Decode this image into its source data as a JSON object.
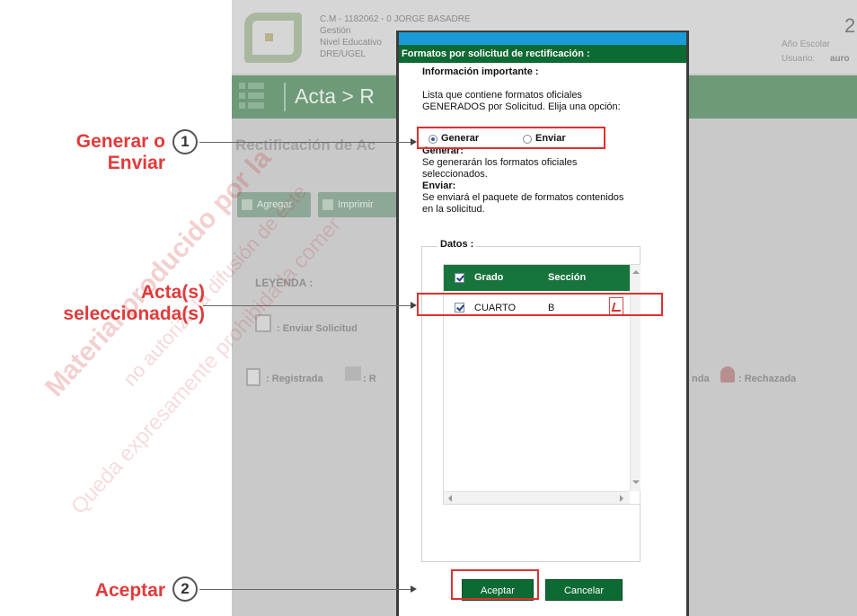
{
  "app": {
    "header": {
      "line1": "C.M - 1182062 - 0  JORGE BASADRE",
      "line2": "Gestión",
      "line3": "Nivel Educativo",
      "line4": "DRE/UGEL",
      "anio_label": "Año Escolar",
      "anio_digit": "2",
      "usuario_label": "Usuario:",
      "usuario_value": "auro"
    },
    "nav_title": "Acta > R",
    "subtitle": "Rectificación de Ac",
    "buttons": {
      "agregar": "Agregar",
      "imprimir": "Imprimir"
    },
    "leyenda": "LEYENDA :",
    "enviar_solicitud": ": Enviar Solicitud",
    "legend_registrada": ": Registrada",
    "legend_r": ": R",
    "legend_nada": "nda",
    "legend_rechazada": ": Rechazada"
  },
  "modal": {
    "title": "Formatos por solicitud de rectificación :",
    "info_heading": "Información importante :",
    "info_text_1": "Lista que contiene formatos oficiales",
    "info_text_2": "GENERADOS por Solicitud. Elija una opción:",
    "radio_generar": "Generar",
    "radio_enviar": "Enviar",
    "selected_option": "Generar",
    "generar_heading": "Generar:",
    "generar_text_1": "Se generarán los formatos oficiales",
    "generar_text_2": "seleccionados.",
    "enviar_heading": "Enviar:",
    "enviar_text_1": "Se enviará el paquete de formatos contenidos",
    "enviar_text_2": "en la solicitud.",
    "datos_label": "Datos :",
    "grid": {
      "columns": [
        "Grado",
        "Sección"
      ],
      "rows": [
        {
          "grado": "CUARTO",
          "seccion": "B",
          "checked": true
        }
      ]
    },
    "btn_aceptar": "Aceptar",
    "btn_cancelar": "Cancelar"
  },
  "annotations": {
    "step1_line1": "Generar o",
    "step1_line2": "Enviar",
    "step1_num": "1",
    "actas_line1": "Acta(s)",
    "actas_line2": "seleccionada(s)",
    "step2_label": "Aceptar",
    "step2_num": "2"
  },
  "watermark": {
    "line1": "Material producido por la",
    "line2": "no autoriza la difusión de este",
    "line3": "Queda expresamente prohibida la comer"
  },
  "colors": {
    "annotation_red": "#e23a3a",
    "dialog_green": "#0e6a33",
    "dialog_blue": "#1a9ad6",
    "app_nav_green": "#6f9a79"
  }
}
